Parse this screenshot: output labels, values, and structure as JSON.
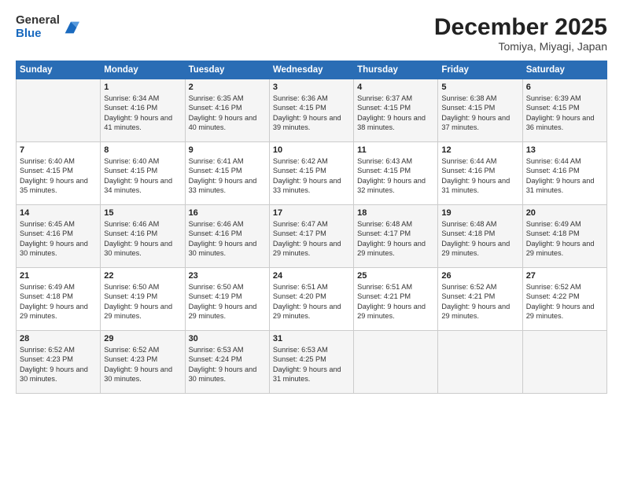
{
  "logo": {
    "general": "General",
    "blue": "Blue"
  },
  "title": "December 2025",
  "subtitle": "Tomiya, Miyagi, Japan",
  "days_header": [
    "Sunday",
    "Monday",
    "Tuesday",
    "Wednesday",
    "Thursday",
    "Friday",
    "Saturday"
  ],
  "weeks": [
    [
      {
        "day": "",
        "sunrise": "",
        "sunset": "",
        "daylight": ""
      },
      {
        "day": "1",
        "sunrise": "6:34 AM",
        "sunset": "4:16 PM",
        "daylight": "9 hours and 41 minutes."
      },
      {
        "day": "2",
        "sunrise": "6:35 AM",
        "sunset": "4:16 PM",
        "daylight": "9 hours and 40 minutes."
      },
      {
        "day": "3",
        "sunrise": "6:36 AM",
        "sunset": "4:15 PM",
        "daylight": "9 hours and 39 minutes."
      },
      {
        "day": "4",
        "sunrise": "6:37 AM",
        "sunset": "4:15 PM",
        "daylight": "9 hours and 38 minutes."
      },
      {
        "day": "5",
        "sunrise": "6:38 AM",
        "sunset": "4:15 PM",
        "daylight": "9 hours and 37 minutes."
      },
      {
        "day": "6",
        "sunrise": "6:39 AM",
        "sunset": "4:15 PM",
        "daylight": "9 hours and 36 minutes."
      }
    ],
    [
      {
        "day": "7",
        "sunrise": "6:40 AM",
        "sunset": "4:15 PM",
        "daylight": "9 hours and 35 minutes."
      },
      {
        "day": "8",
        "sunrise": "6:40 AM",
        "sunset": "4:15 PM",
        "daylight": "9 hours and 34 minutes."
      },
      {
        "day": "9",
        "sunrise": "6:41 AM",
        "sunset": "4:15 PM",
        "daylight": "9 hours and 33 minutes."
      },
      {
        "day": "10",
        "sunrise": "6:42 AM",
        "sunset": "4:15 PM",
        "daylight": "9 hours and 33 minutes."
      },
      {
        "day": "11",
        "sunrise": "6:43 AM",
        "sunset": "4:15 PM",
        "daylight": "9 hours and 32 minutes."
      },
      {
        "day": "12",
        "sunrise": "6:44 AM",
        "sunset": "4:16 PM",
        "daylight": "9 hours and 31 minutes."
      },
      {
        "day": "13",
        "sunrise": "6:44 AM",
        "sunset": "4:16 PM",
        "daylight": "9 hours and 31 minutes."
      }
    ],
    [
      {
        "day": "14",
        "sunrise": "6:45 AM",
        "sunset": "4:16 PM",
        "daylight": "9 hours and 30 minutes."
      },
      {
        "day": "15",
        "sunrise": "6:46 AM",
        "sunset": "4:16 PM",
        "daylight": "9 hours and 30 minutes."
      },
      {
        "day": "16",
        "sunrise": "6:46 AM",
        "sunset": "4:16 PM",
        "daylight": "9 hours and 30 minutes."
      },
      {
        "day": "17",
        "sunrise": "6:47 AM",
        "sunset": "4:17 PM",
        "daylight": "9 hours and 29 minutes."
      },
      {
        "day": "18",
        "sunrise": "6:48 AM",
        "sunset": "4:17 PM",
        "daylight": "9 hours and 29 minutes."
      },
      {
        "day": "19",
        "sunrise": "6:48 AM",
        "sunset": "4:18 PM",
        "daylight": "9 hours and 29 minutes."
      },
      {
        "day": "20",
        "sunrise": "6:49 AM",
        "sunset": "4:18 PM",
        "daylight": "9 hours and 29 minutes."
      }
    ],
    [
      {
        "day": "21",
        "sunrise": "6:49 AM",
        "sunset": "4:18 PM",
        "daylight": "9 hours and 29 minutes."
      },
      {
        "day": "22",
        "sunrise": "6:50 AM",
        "sunset": "4:19 PM",
        "daylight": "9 hours and 29 minutes."
      },
      {
        "day": "23",
        "sunrise": "6:50 AM",
        "sunset": "4:19 PM",
        "daylight": "9 hours and 29 minutes."
      },
      {
        "day": "24",
        "sunrise": "6:51 AM",
        "sunset": "4:20 PM",
        "daylight": "9 hours and 29 minutes."
      },
      {
        "day": "25",
        "sunrise": "6:51 AM",
        "sunset": "4:21 PM",
        "daylight": "9 hours and 29 minutes."
      },
      {
        "day": "26",
        "sunrise": "6:52 AM",
        "sunset": "4:21 PM",
        "daylight": "9 hours and 29 minutes."
      },
      {
        "day": "27",
        "sunrise": "6:52 AM",
        "sunset": "4:22 PM",
        "daylight": "9 hours and 29 minutes."
      }
    ],
    [
      {
        "day": "28",
        "sunrise": "6:52 AM",
        "sunset": "4:23 PM",
        "daylight": "9 hours and 30 minutes."
      },
      {
        "day": "29",
        "sunrise": "6:52 AM",
        "sunset": "4:23 PM",
        "daylight": "9 hours and 30 minutes."
      },
      {
        "day": "30",
        "sunrise": "6:53 AM",
        "sunset": "4:24 PM",
        "daylight": "9 hours and 30 minutes."
      },
      {
        "day": "31",
        "sunrise": "6:53 AM",
        "sunset": "4:25 PM",
        "daylight": "9 hours and 31 minutes."
      },
      {
        "day": "",
        "sunrise": "",
        "sunset": "",
        "daylight": ""
      },
      {
        "day": "",
        "sunrise": "",
        "sunset": "",
        "daylight": ""
      },
      {
        "day": "",
        "sunrise": "",
        "sunset": "",
        "daylight": ""
      }
    ]
  ],
  "labels": {
    "sunrise": "Sunrise:",
    "sunset": "Sunset:",
    "daylight": "Daylight:"
  }
}
